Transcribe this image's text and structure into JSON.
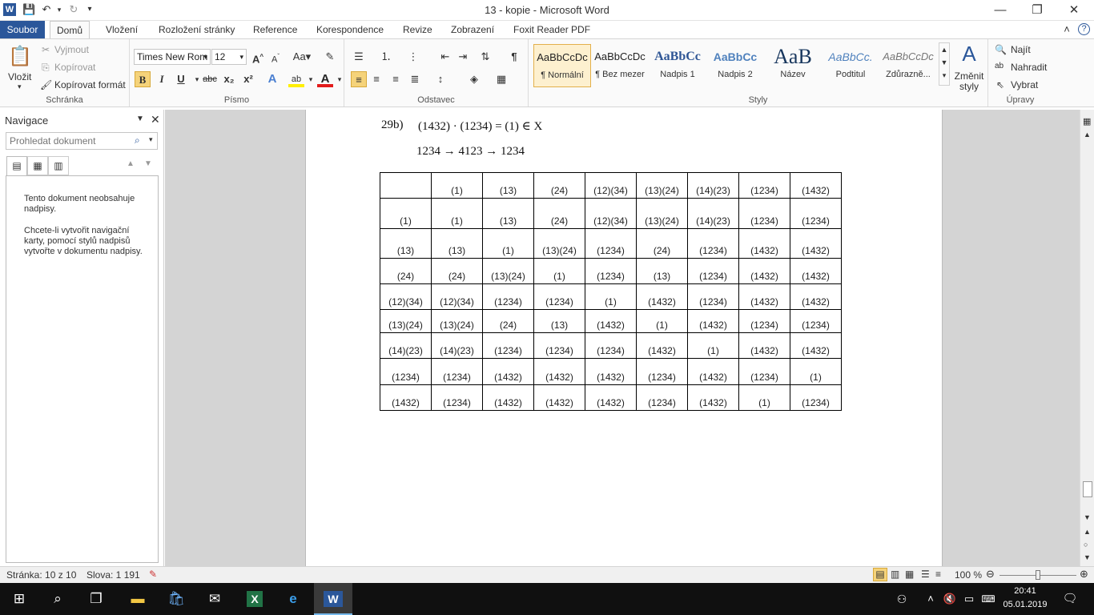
{
  "window": {
    "title": "13 - kopie  -  Microsoft Word"
  },
  "tabs": [
    "Soubor",
    "Domů",
    "Vložení",
    "Rozložení stránky",
    "Reference",
    "Korespondence",
    "Revize",
    "Zobrazení",
    "Foxit Reader PDF"
  ],
  "clipboard": {
    "paste": "Vložit",
    "cut": "Vyjmout",
    "copy": "Kopírovat",
    "format_painter": "Kopírovat formát",
    "label": "Schránka"
  },
  "font": {
    "name": "Times New Rom",
    "size": "12",
    "label": "Písmo",
    "bold": "B",
    "italic": "I",
    "underline": "U",
    "strike": "abc",
    "sub": "x₂",
    "sup": "x²"
  },
  "paragraph": {
    "label": "Odstavec"
  },
  "styles": {
    "label": "Styly",
    "items": [
      {
        "preview": "AaBbCcDc",
        "name": "¶ Normální"
      },
      {
        "preview": "AaBbCcDc",
        "name": "¶ Bez mezer"
      },
      {
        "preview": "AaBbCc",
        "name": "Nadpis 1"
      },
      {
        "preview": "AaBbCc",
        "name": "Nadpis 2"
      },
      {
        "preview": "AaB",
        "name": "Název"
      },
      {
        "preview": "AaBbCc.",
        "name": "Podtitul"
      },
      {
        "preview": "AaBbCcDc",
        "name": "Zdůrazně..."
      }
    ],
    "change_styles": "Změnit styly"
  },
  "editing": {
    "find": "Najít",
    "replace": "Nahradit",
    "select": "Vybrat",
    "label": "Úpravy"
  },
  "nav_pane": {
    "title": "Navigace",
    "search_placeholder": "Prohledat dokument",
    "msg1": "Tento dokument neobsahuje nadpisy.",
    "msg2": "Chcete-li vytvořit navigační karty, pomocí stylů nadpisů vytvořte v dokumentu nadpisy."
  },
  "document": {
    "line1_label": "29b)",
    "line1_expr": "(1432) · (1234) = (1) ∈ X",
    "line2": "1234 → 4123 → 1234",
    "table": [
      [
        "",
        "(1)",
        "(13)",
        "(24)",
        "(12)(34)",
        "(13)(24)",
        "(14)(23)",
        "(1234)",
        "(1432)"
      ],
      [
        "(1)",
        "(1)",
        "(13)",
        "(24)",
        "(12)(34)",
        "(13)(24)",
        "(14)(23)",
        "(1234)",
        "(1234)"
      ],
      [
        "(13)",
        "(13)",
        "(1)",
        "(13)(24)",
        "(1234)",
        "(24)",
        "(1234)",
        "(1432)",
        "(1432)"
      ],
      [
        "(24)",
        "(24)",
        "(13)(24)",
        "(1)",
        "(1234)",
        "(13)",
        "(1234)",
        "(1432)",
        "(1432)"
      ],
      [
        "(12)(34)",
        "(12)(34)",
        "(1234)",
        "(1234)",
        "(1)",
        "(1432)",
        "(1234)",
        "(1432)",
        "(1432)"
      ],
      [
        "(13)(24)",
        "(13)(24)",
        "(24)",
        "(13)",
        "(1432)",
        "(1)",
        "(1432)",
        "(1234)",
        "(1234)"
      ],
      [
        "(14)(23)",
        "(14)(23)",
        "(1234)",
        "(1234)",
        "(1234)",
        "(1432)",
        "(1)",
        "(1432)",
        "(1432)"
      ],
      [
        "(1234)",
        "(1234)",
        "(1432)",
        "(1432)",
        "(1432)",
        "(1234)",
        "(1432)",
        "(1234)",
        "(1)"
      ],
      [
        "(1432)",
        "(1234)",
        "(1432)",
        "(1432)",
        "(1432)",
        "(1234)",
        "(1432)",
        "(1)",
        "(1234)"
      ]
    ]
  },
  "status": {
    "page": "Stránka: 10 z 10",
    "words": "Slova: 1 191",
    "zoom": "100 %"
  },
  "taskbar": {
    "time": "20:41",
    "date": "05.01.2019"
  }
}
